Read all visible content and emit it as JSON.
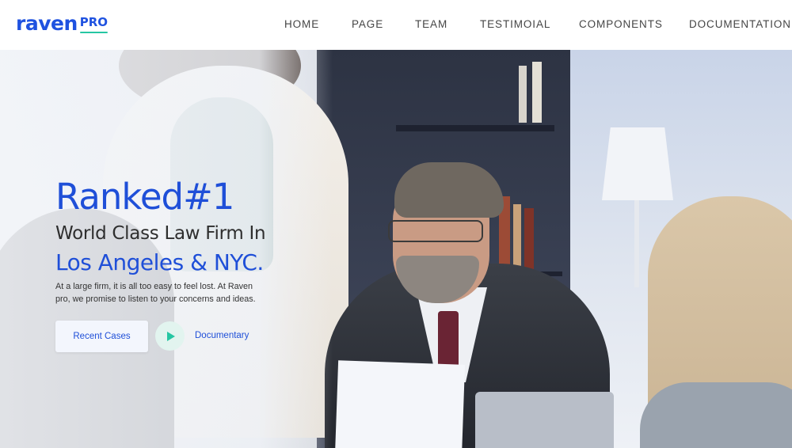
{
  "brand": {
    "name": "raven",
    "suffix": "PRO"
  },
  "nav": {
    "items": [
      {
        "label": "HOME"
      },
      {
        "label": "PAGE"
      },
      {
        "label": "TEAM"
      },
      {
        "label": "TESTIMOIAL"
      },
      {
        "label": "COMPONENTS"
      },
      {
        "label": "DOCUMENTATION"
      }
    ]
  },
  "hero": {
    "ranked": "Ranked",
    "rank_number": "#1",
    "subtitle": "World Class Law Firm In",
    "location": "Los Angeles & NYC.",
    "description": "At a large firm, it is all too easy to feel lost. At Raven pro, we promise to listen to your concerns and ideas.",
    "primary_button": "Recent Cases",
    "video_link": "Documentary"
  },
  "colors": {
    "accent": "#1f4fd8",
    "brand_underline": "#26c6a3",
    "play_icon": "#26c6a3"
  },
  "icons": {
    "video_link": "play-icon"
  }
}
